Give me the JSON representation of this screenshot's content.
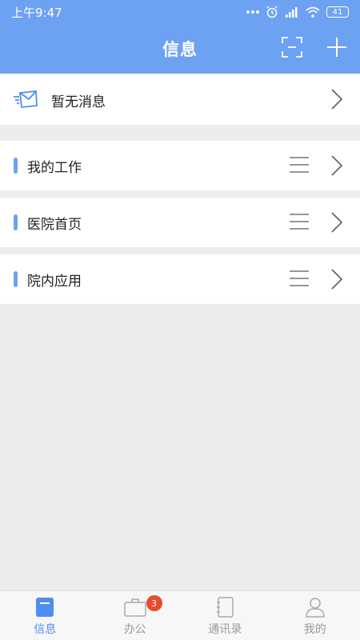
{
  "status_bar": {
    "time": "上午9:47",
    "battery": "41"
  },
  "header": {
    "title": "信息",
    "icons": [
      "scan-icon",
      "plus-icon"
    ]
  },
  "message_row": {
    "icon": "mail-icon",
    "label": "暂无消息"
  },
  "sections": [
    {
      "label": "我的工作"
    },
    {
      "label": "医院首页"
    },
    {
      "label": "院内应用"
    }
  ],
  "tabs": [
    {
      "label": "信息",
      "icon": "chat-icon",
      "active": true
    },
    {
      "label": "办公",
      "icon": "briefcase-icon",
      "badge": "3"
    },
    {
      "label": "通讯录",
      "icon": "contacts-icon"
    },
    {
      "label": "我的",
      "icon": "person-icon"
    }
  ],
  "colors": {
    "primary": "#6da2f2",
    "badge": "#e94b2f",
    "background": "#ececec"
  }
}
